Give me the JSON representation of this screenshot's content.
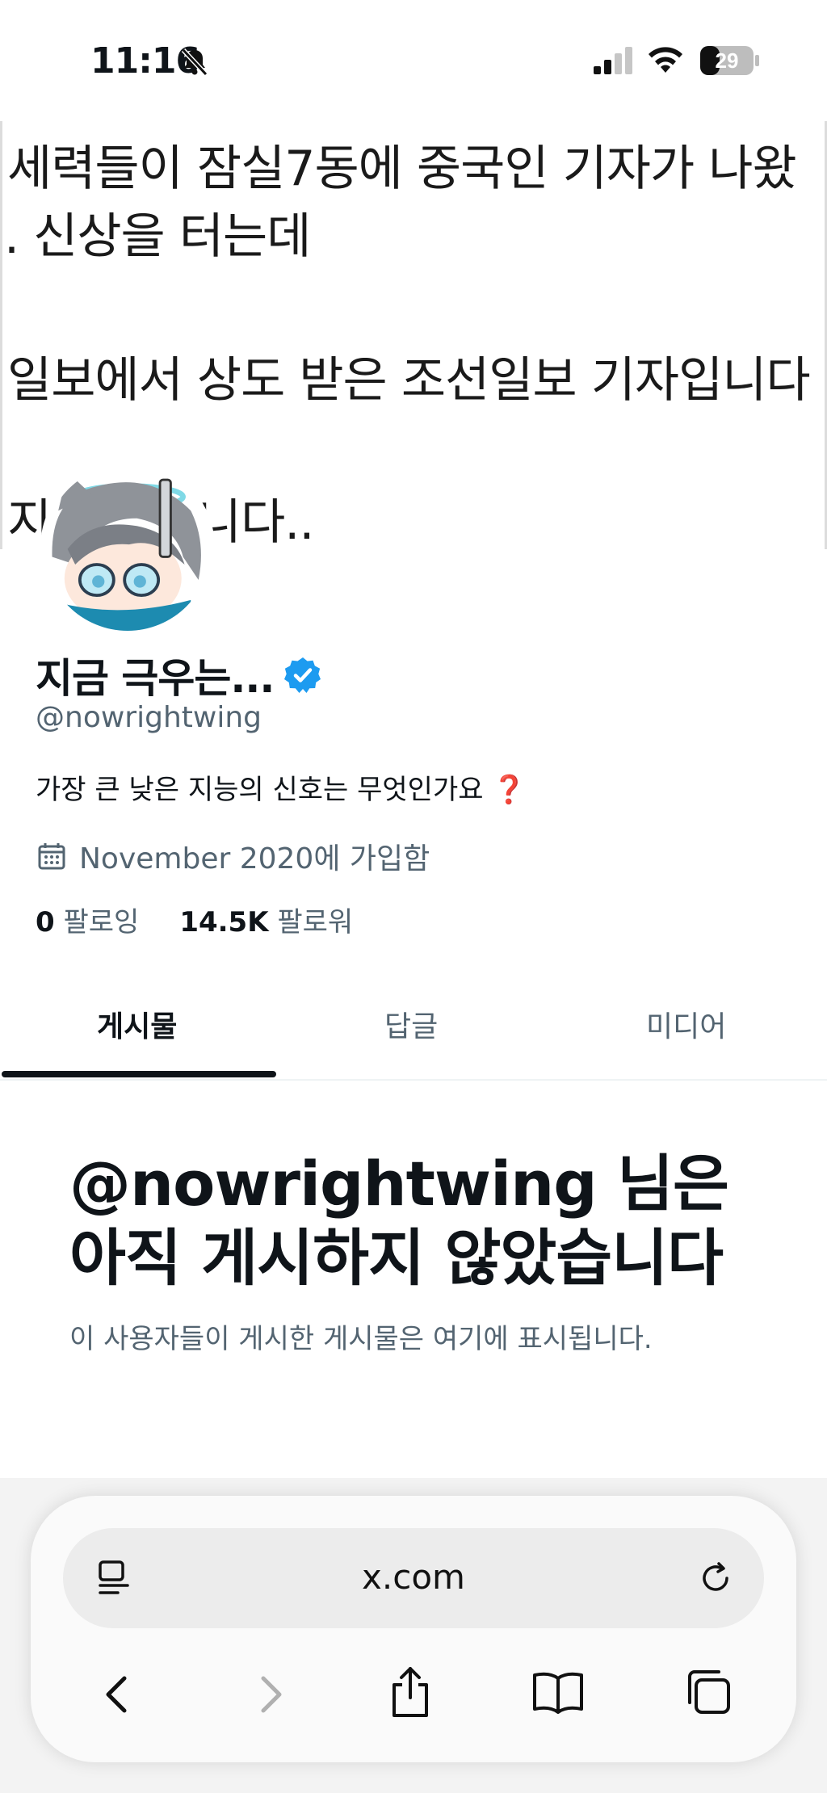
{
  "status_bar": {
    "time": "11:16",
    "battery": "29"
  },
  "banner": {
    "lines": [
      "세력들이 잠실7동에 중국인 기자가 나왔",
      ". 신상을 터는데",
      "일보에서 상도 받은 조선일보 기자입니다",
      "지      많으십니다.."
    ]
  },
  "profile": {
    "name": "지금 극우는...",
    "handle": "@nowrightwing",
    "bio": "가장 큰 낮은 지능의 신호는 무엇인가요",
    "bio_emoji": "❓",
    "joined": "November 2020에 가입함",
    "following_count": "0",
    "following_label": "팔로잉",
    "followers_count": "14.5K",
    "followers_label": "팔로워"
  },
  "tabs": [
    {
      "label": "게시물",
      "active": true
    },
    {
      "label": "답글",
      "active": false
    },
    {
      "label": "미디어",
      "active": false
    }
  ],
  "empty_state": {
    "title_line1": "@nowrightwing 님은",
    "title_line2": "아직 게시하지 않았습니다",
    "subtitle": "이 사용자들이 게시한 게시물은 여기에 표시됩니다."
  },
  "browser": {
    "url": "x.com",
    "icons": [
      "reader-icon",
      "reload-icon",
      "back-icon",
      "forward-icon",
      "share-icon",
      "bookmarks-icon",
      "tabs-icon"
    ]
  },
  "colors": {
    "verified": "#1d9bf0",
    "secondary_text": "#536471",
    "primary_text": "#0f1419"
  }
}
